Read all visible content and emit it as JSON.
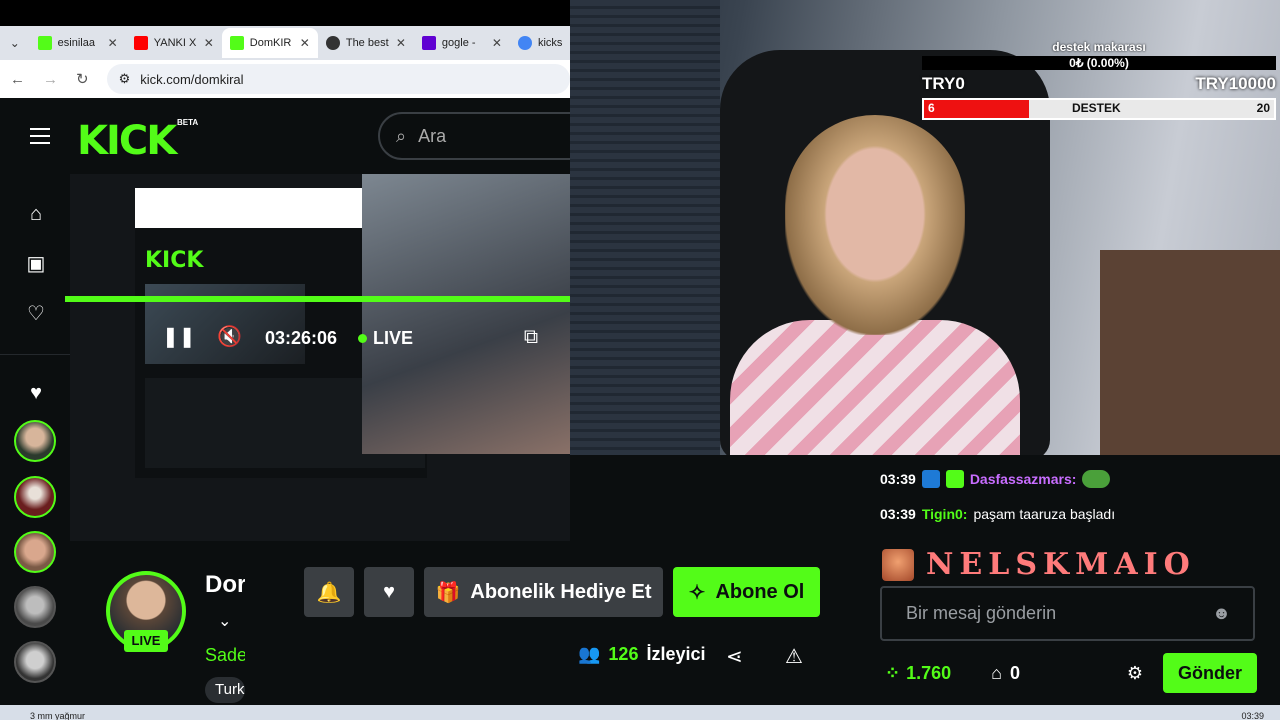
{
  "browser": {
    "tabs": [
      {
        "label": "esinilaa",
        "color": "#53fc18"
      },
      {
        "label": "YANKI X",
        "color": "#ff0000"
      },
      {
        "label": "DomKIR",
        "color": "#53fc18",
        "active": true
      },
      {
        "label": "The best",
        "color": "#333333"
      },
      {
        "label": "gogle - ",
        "color": "#6001d2"
      },
      {
        "label": "kicks s",
        "color": "#4285f4"
      }
    ],
    "tab_close": "✕",
    "tab_dropdown": "⌄",
    "url": "kick.com/domkiral"
  },
  "header": {
    "logo": "KICK",
    "beta": "BETA",
    "search_placeholder": "Ara"
  },
  "goal": {
    "title": "destek makarası",
    "bar_text": "0₺ (0.00%)",
    "left_label": "TRY0",
    "right_label": "TRY10000",
    "destek_left": "6",
    "destek_label": "DESTEK",
    "destek_right": "20",
    "destek_fill_fraction": 0.3
  },
  "player": {
    "time": "03:26:06",
    "live": "LIVE"
  },
  "chat": {
    "messages": [
      {
        "time": "03:39",
        "user": "Dasfassazmars:",
        "text": ""
      },
      {
        "time": "03:39",
        "user": "Tigin0:",
        "text": "paşam taaruza başladı"
      }
    ],
    "banner": "NELSKMAIO",
    "input_placeholder": "Bir mesaj gönderin",
    "points": "1.760",
    "count": "0",
    "send": "Gönder"
  },
  "channel": {
    "name": "Dor",
    "category": "Sade",
    "tag": "Turk",
    "live": "LIVE",
    "gift_label": "Abonelik Hediye Et",
    "sub_label": "Abone Ol",
    "viewers_count": "126",
    "viewers_label": "İzleyici"
  },
  "taskbar": {
    "weather": "3 mm yağmur",
    "clock": "03:39"
  },
  "colors": {
    "accent": "#53fc18",
    "background": "#0b0e0f"
  }
}
